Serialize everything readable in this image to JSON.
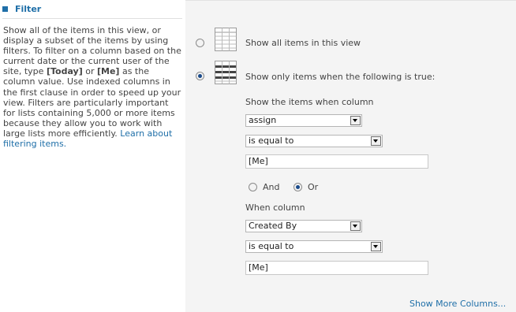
{
  "section": {
    "title": "Filter"
  },
  "description": {
    "part1": "Show all of the items in this view, or display a subset of the items by using filters. To filter on a column based on the current date or the current user of the site, type ",
    "today_token": "[Today]",
    "or_word": " or ",
    "me_token": "[Me]",
    "part2": " as the column value. Use indexed columns in the first clause in order to speed up your view. Filters are particularly important for lists containing 5,000 or more items because they allow you to work with large lists more efficiently. ",
    "link": "Learn about filtering items."
  },
  "options": {
    "show_all": {
      "label": "Show all items in this view",
      "selected": false
    },
    "show_filtered": {
      "label": "Show only items when the following is true:",
      "selected": true
    }
  },
  "clause1": {
    "label": "Show the items when column",
    "column": "assign",
    "operator": "is equal to",
    "value": "[Me]"
  },
  "connector": {
    "and_label": "And",
    "or_label": "Or",
    "selected": "Or"
  },
  "clause2": {
    "label": "When column",
    "column": "Created By",
    "operator": "is equal to",
    "value": "[Me]"
  },
  "footer": {
    "show_more": "Show More Columns..."
  },
  "colors": {
    "link": "#1f6fa8",
    "panel": "#f4f4f4",
    "radio_dot": "#1a4a8a"
  },
  "icons": {
    "all_items": "grid-list-icon",
    "filtered_items": "filtered-grid-icon"
  }
}
